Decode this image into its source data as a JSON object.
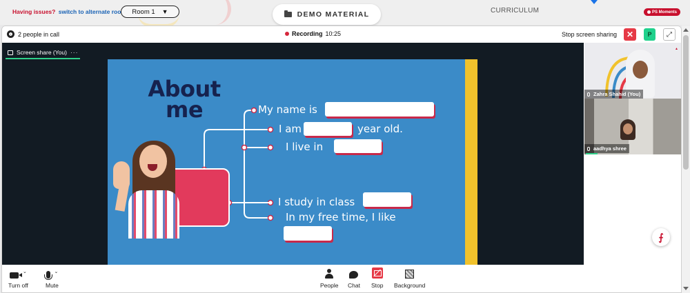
{
  "topbar": {
    "issues_label": "Having issues?",
    "alternate_link": "switch to alternate room",
    "room_select": "Room 1",
    "demo_material": "DEMO MATERIAL",
    "curriculum": "CURRICULUM",
    "ps_moments": "PS Moments"
  },
  "call": {
    "people_count": "2 people in call",
    "recording_label": "Recording",
    "recording_time": "10:25",
    "stop_screen_sharing": "Stop screen sharing",
    "participant_initial": "P"
  },
  "screen_share": {
    "tab_label": "Screen share (You)",
    "menu": "···"
  },
  "slide": {
    "title_line1": "About",
    "title_line2": "me",
    "line_name": "My name is",
    "line_age_prefix": "I am",
    "line_age_suffix": "year old.",
    "line_live": "I live in",
    "line_class": "I study in class",
    "line_free": "In my free time, I like"
  },
  "participants": [
    {
      "name": "Zahra Shahid (You)"
    },
    {
      "name": "aadhya shree"
    }
  ],
  "toolbar": {
    "turn_off": "Turn off",
    "mute": "Mute",
    "people": "People",
    "chat": "Chat",
    "stop": "Stop",
    "background": "Background"
  },
  "colors": {
    "slide_bg": "#3b8bc8",
    "accent_red": "#e63946",
    "accent_green": "#2fd18a",
    "title_navy": "#16224e"
  }
}
